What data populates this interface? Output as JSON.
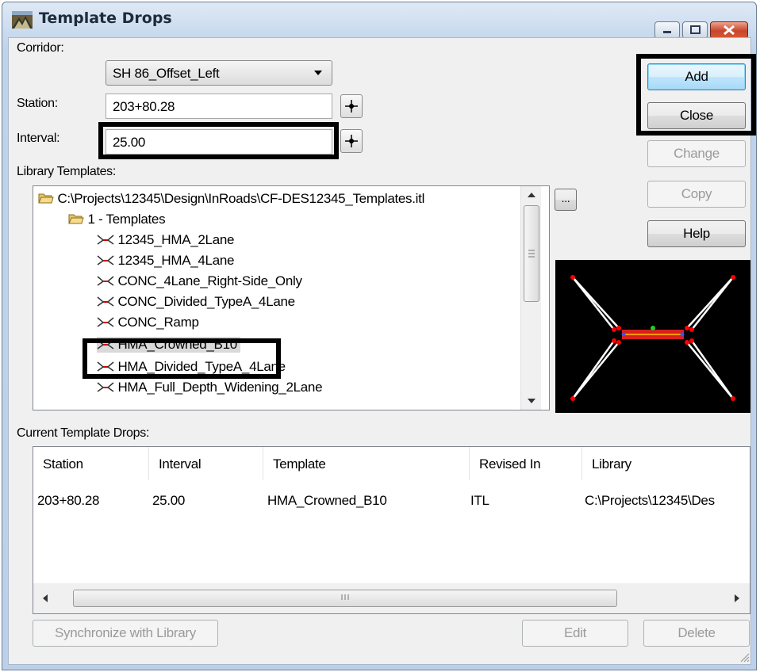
{
  "window": {
    "title": "Template Drops"
  },
  "form": {
    "corridor_label": "Corridor:",
    "corridor_value": "SH 86_Offset_Left",
    "station_label": "Station:",
    "station_value": "203+80.28",
    "interval_label": "Interval:",
    "interval_value": "25.00",
    "library_label": "Library Templates:"
  },
  "buttons": {
    "add": "Add",
    "close": "Close",
    "change": "Change",
    "copy": "Copy",
    "help": "Help",
    "browse": "...",
    "synchronize": "Synchronize with Library",
    "edit": "Edit",
    "delete": "Delete"
  },
  "tree": {
    "root": "C:\\Projects\\12345\\Design\\InRoads\\CF-DES12345_Templates.itl",
    "folder": "1 - Templates",
    "items": [
      "12345_HMA_2Lane",
      "12345_HMA_4Lane",
      "CONC_4Lane_Right-Side_Only",
      "CONC_Divided_TypeA_4Lane",
      "CONC_Ramp",
      "HMA_Crowned_B10",
      "HMA_Divided_TypeA_4Lane",
      "HMA_Full_Depth_Widening_2Lane"
    ],
    "selected": "HMA_Crowned_B10"
  },
  "current": {
    "label": "Current Template Drops:",
    "columns": [
      "Station",
      "Interval",
      "Template",
      "Revised In",
      "Library"
    ],
    "rows": [
      [
        "203+80.28",
        "25.00",
        "HMA_Crowned_B10",
        "ITL",
        "C:\\Projects\\12345\\Des"
      ]
    ]
  },
  "colors": {
    "preview_bg": "#000000",
    "preview_lines": "#ffffff",
    "preview_points": "#ff0000",
    "highlight": "#000000"
  }
}
